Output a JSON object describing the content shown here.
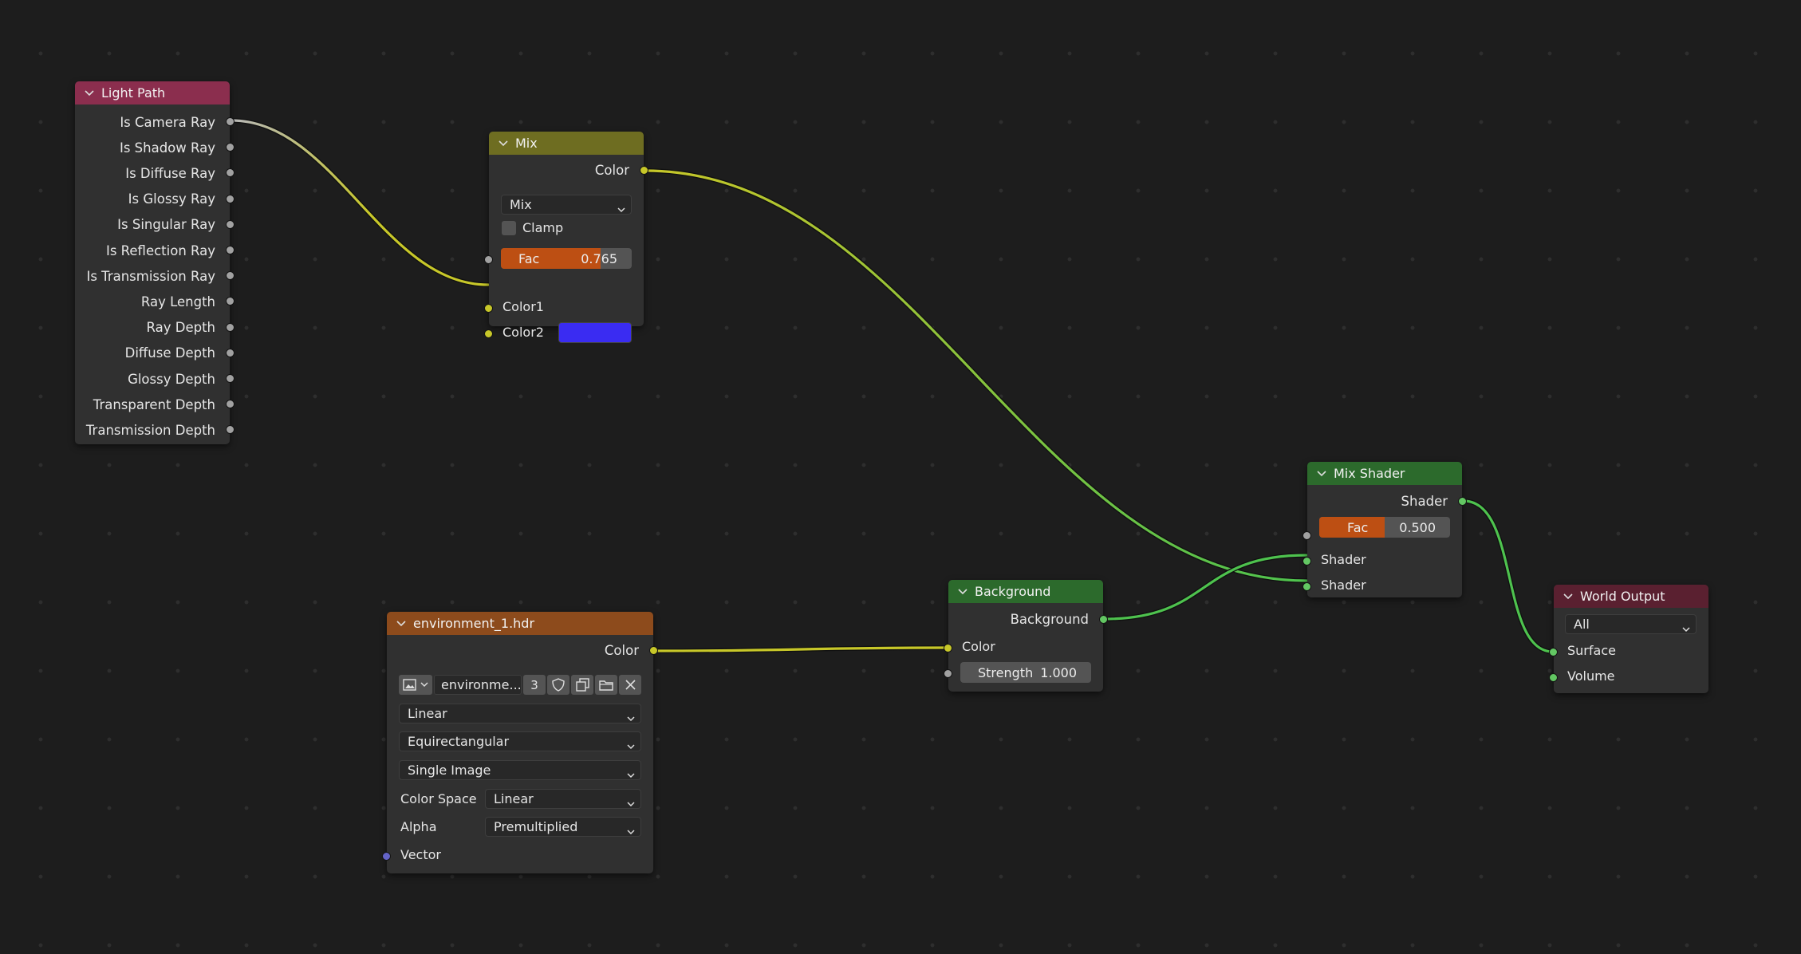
{
  "colors": {
    "wire_yellow": "#c7c729",
    "wire_green": "#4ec24e",
    "header_light_path": "#8b2e4e",
    "header_mix": "#6e6d21",
    "header_mix_shader": "#2c6a2c",
    "header_background": "#2c6a2c",
    "header_image": "#8d4b1c",
    "header_world_output": "#5a2030",
    "color2_value": "#3a2cf2"
  },
  "nodes": {
    "light_path": {
      "title": "Light Path",
      "outputs": [
        "Is Camera Ray",
        "Is Shadow Ray",
        "Is Diffuse Ray",
        "Is Glossy Ray",
        "Is Singular Ray",
        "Is Reflection Ray",
        "Is Transmission Ray",
        "Ray Length",
        "Ray Depth",
        "Diffuse Depth",
        "Glossy Depth",
        "Transparent Depth",
        "Transmission Depth"
      ]
    },
    "mix": {
      "title": "Mix",
      "output": "Color",
      "blend_mode": "Mix",
      "clamp_label": "Clamp",
      "clamp_checked": false,
      "fac_label": "Fac",
      "fac_value": "0.765",
      "fac_fraction": 0.765,
      "color1_label": "Color1",
      "color2_label": "Color2"
    },
    "mix_shader": {
      "title": "Mix Shader",
      "output": "Shader",
      "fac_label": "Fac",
      "fac_value": "0.500",
      "fac_fraction": 0.5,
      "input1": "Shader",
      "input2": "Shader"
    },
    "background": {
      "title": "Background",
      "output": "Background",
      "color_label": "Color",
      "strength_label": "Strength",
      "strength_value": "1.000"
    },
    "environment": {
      "title": "environment_1.hdr",
      "output": "Color",
      "image_name": "environme...",
      "users": "3",
      "interpolation": "Linear",
      "projection": "Equirectangular",
      "source": "Single Image",
      "color_space_label": "Color Space",
      "color_space": "Linear",
      "alpha_label": "Alpha",
      "alpha": "Premultiplied",
      "vector_label": "Vector"
    },
    "world_output": {
      "title": "World Output",
      "target": "All",
      "surface_label": "Surface",
      "volume_label": "Volume"
    }
  }
}
